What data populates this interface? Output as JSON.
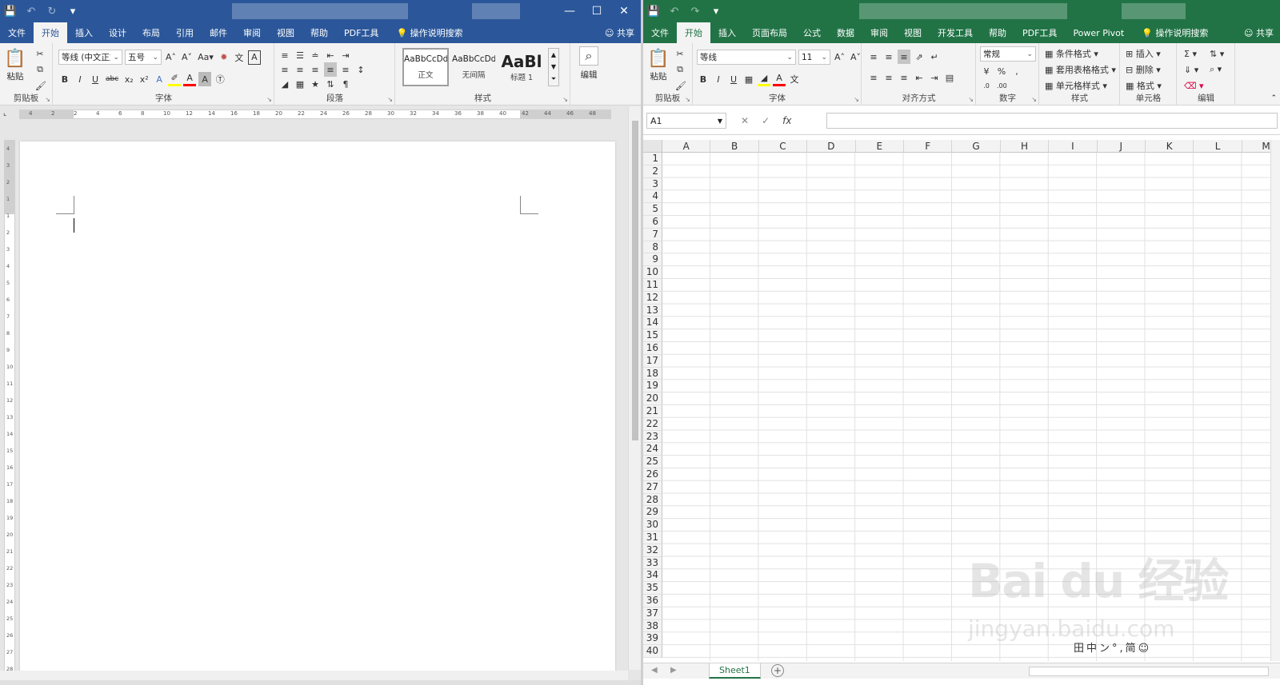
{
  "word": {
    "tabs": [
      "文件",
      "开始",
      "插入",
      "设计",
      "布局",
      "引用",
      "邮件",
      "审阅",
      "视图",
      "帮助",
      "PDF工具"
    ],
    "active_tab": "开始",
    "search": "操作说明搜索",
    "share": "共享",
    "clipboard": {
      "paste": "粘贴",
      "label": "剪贴板"
    },
    "font": {
      "name": "等线 (中文正文)",
      "size": "五号",
      "label": "字体"
    },
    "paragraph_label": "段落",
    "styles": {
      "items": [
        {
          "preview": "AaBbCcDd",
          "name": "正文"
        },
        {
          "preview": "AaBbCcDd",
          "name": "无间隔"
        },
        {
          "preview": "AaBl",
          "name": "标题 1"
        }
      ],
      "label": "样式"
    },
    "edit_label": "编辑",
    "ruler_numbers": [
      "4",
      "2",
      "2",
      "4",
      "6",
      "8",
      "10",
      "12",
      "14",
      "16",
      "18",
      "20",
      "22",
      "24",
      "26",
      "28",
      "30",
      "32",
      "34",
      "36",
      "38",
      "40",
      "42",
      "44",
      "46",
      "48"
    ],
    "vruler_numbers": [
      "4",
      "3",
      "2",
      "1",
      "1",
      "2",
      "3",
      "4",
      "5",
      "6",
      "7",
      "8",
      "9",
      "10",
      "11",
      "12",
      "13",
      "14",
      "15",
      "16",
      "17",
      "18",
      "19",
      "20",
      "21",
      "22",
      "23",
      "24",
      "25",
      "26",
      "27",
      "28"
    ]
  },
  "excel": {
    "tabs": [
      "文件",
      "开始",
      "插入",
      "页面布局",
      "公式",
      "数据",
      "审阅",
      "视图",
      "开发工具",
      "帮助",
      "PDF工具",
      "Power Pivot"
    ],
    "active_tab": "开始",
    "search": "操作说明搜索",
    "share": "共享",
    "clipboard": {
      "paste": "粘贴",
      "label": "剪贴板"
    },
    "font": {
      "name": "等线",
      "size": "11",
      "label": "字体"
    },
    "alignment_label": "对齐方式",
    "number": {
      "format": "常规",
      "label": "数字"
    },
    "styles": {
      "items": [
        "条件格式",
        "套用表格格式",
        "单元格样式"
      ],
      "label": "样式"
    },
    "cells": {
      "items": [
        "插入",
        "删除",
        "格式"
      ],
      "label": "单元格"
    },
    "edit_label": "编辑",
    "name_box": "A1",
    "fx": "fx",
    "columns": [
      "A",
      "B",
      "C",
      "D",
      "E",
      "F",
      "G",
      "H",
      "I",
      "J",
      "K",
      "L",
      "M"
    ],
    "rows": [
      "1",
      "2",
      "3",
      "4",
      "5",
      "6",
      "7",
      "8",
      "9",
      "10",
      "11",
      "12",
      "13",
      "14",
      "15",
      "16",
      "17",
      "18",
      "19",
      "20",
      "21",
      "22",
      "23",
      "24",
      "25",
      "26",
      "27",
      "28",
      "29",
      "30",
      "31",
      "32",
      "33",
      "34",
      "35",
      "36",
      "37",
      "38",
      "39",
      "40"
    ],
    "sheet_tab": "Sheet1"
  },
  "watermark": {
    "logo": "Bai du 经验",
    "url": "jingyan.baidu.com"
  },
  "ime_icons": "田中ン°,简☺"
}
